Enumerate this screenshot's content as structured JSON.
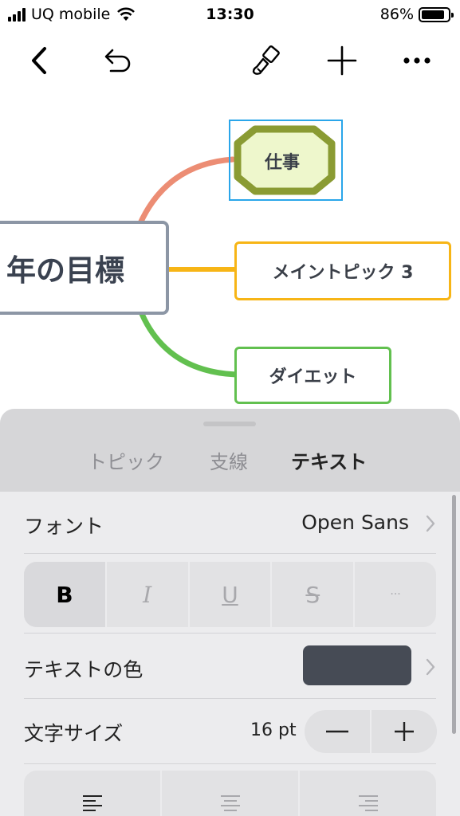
{
  "status_bar": {
    "carrier": "UQ mobile",
    "time": "13:30",
    "battery_percent": "86%",
    "battery_level": 0.86
  },
  "toolbar": {
    "icons": [
      "back-icon",
      "undo-icon",
      "paint-brush-icon",
      "plus-icon",
      "more-icon"
    ]
  },
  "mindmap": {
    "central_topic": "年の目標",
    "branches": [
      {
        "label": "仕事",
        "color": "#ec8d74",
        "border": "#8a9b33",
        "fill": "#eef7cc",
        "selected": true
      },
      {
        "label": "メイントピック 3",
        "color": "#f7b516",
        "border": "#f7b516"
      },
      {
        "label": "ダイエット",
        "color": "#62c04f",
        "border": "#62c04f"
      }
    ],
    "selection_color": "#2aa6ea"
  },
  "sheet": {
    "tabs": [
      {
        "label": "トピック",
        "active": false
      },
      {
        "label": "支線",
        "active": false
      },
      {
        "label": "テキスト",
        "active": true
      }
    ],
    "font": {
      "label": "フォント",
      "value": "Open Sans"
    },
    "style_buttons": [
      "B",
      "I",
      "U",
      "S",
      "···"
    ],
    "text_color": {
      "label": "テキストの色",
      "color": "#464b55"
    },
    "font_size": {
      "label": "文字サイズ",
      "value": "16 pt",
      "minus": "—",
      "plus": "+"
    },
    "alignment": [
      "align-left-icon",
      "align-center-icon",
      "align-right-icon"
    ]
  }
}
